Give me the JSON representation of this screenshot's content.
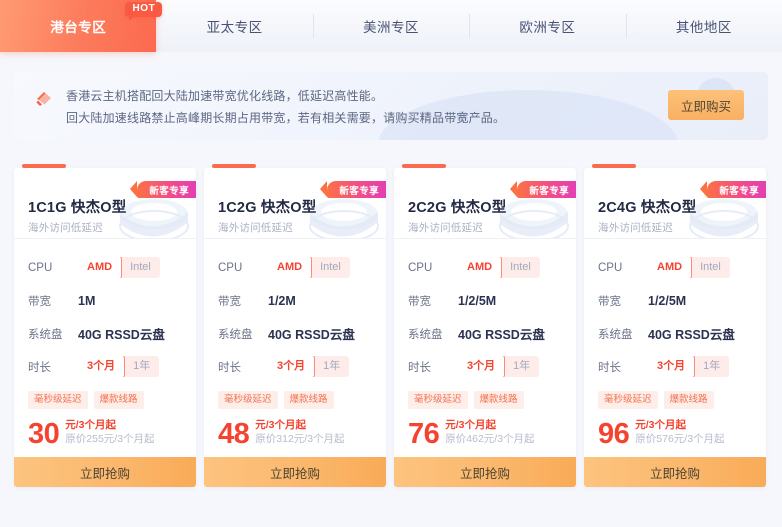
{
  "tabs": [
    {
      "label": "港台专区",
      "active": true,
      "badge": "HOT"
    },
    {
      "label": "亚太专区",
      "active": false,
      "badge": ""
    },
    {
      "label": "美洲专区",
      "active": false,
      "badge": ""
    },
    {
      "label": "欧洲专区",
      "active": false,
      "badge": ""
    },
    {
      "label": "其他地区",
      "active": false,
      "badge": ""
    }
  ],
  "notice": {
    "icon": "megaphone-icon",
    "line1": "香港云主机搭配回大陆加速带宽优化线路，低延迟高性能。",
    "line2": "回大陆加速线路禁止高峰期长期占用带宽，若有相关需要，请购买精品带宽产品。",
    "buy_label": "立即购买"
  },
  "labels": {
    "cpu": "CPU",
    "bandwidth": "带宽",
    "disk": "系统盘",
    "duration": "时长",
    "badge": "新客专享",
    "subtitle": "海外访问低延迟",
    "buy_now": "立即抢购",
    "cpu_amd": "AMD",
    "cpu_intel": "Intel",
    "dur_3m": "3个月",
    "dur_1y": "1年"
  },
  "colors": {
    "accent": "#fb6a4f",
    "price": "#f5432f",
    "button": "#fbb96f",
    "badge_start": "#fc7144",
    "badge_end": "#e23fb4"
  },
  "cards": [
    {
      "title": "1C1G 快杰O型",
      "subtitle": "海外访问低延迟",
      "badge": "新客专享",
      "cpu_selected": "AMD",
      "bandwidth": "1M",
      "disk": "40G RSSD云盘",
      "duration_selected": "3个月",
      "tags": [
        "毫秒级延迟",
        "爆款线路"
      ],
      "price": "30",
      "price_unit": "元/3个月起",
      "price_original": "原价255元/3个月起",
      "button": "立即抢购"
    },
    {
      "title": "1C2G 快杰O型",
      "subtitle": "海外访问低延迟",
      "badge": "新客专享",
      "cpu_selected": "AMD",
      "bandwidth": "1/2M",
      "disk": "40G RSSD云盘",
      "duration_selected": "3个月",
      "tags": [
        "毫秒级延迟",
        "爆款线路"
      ],
      "price": "48",
      "price_unit": "元/3个月起",
      "price_original": "原价312元/3个月起",
      "button": "立即抢购"
    },
    {
      "title": "2C2G 快杰O型",
      "subtitle": "海外访问低延迟",
      "badge": "新客专享",
      "cpu_selected": "AMD",
      "bandwidth": "1/2/5M",
      "disk": "40G RSSD云盘",
      "duration_selected": "3个月",
      "tags": [
        "毫秒级延迟",
        "爆款线路"
      ],
      "price": "76",
      "price_unit": "元/3个月起",
      "price_original": "原价462元/3个月起",
      "button": "立即抢购"
    },
    {
      "title": "2C4G 快杰O型",
      "subtitle": "海外访问低延迟",
      "badge": "新客专享",
      "cpu_selected": "AMD",
      "bandwidth": "1/2/5M",
      "disk": "40G RSSD云盘",
      "duration_selected": "3个月",
      "tags": [
        "毫秒级延迟",
        "爆款线路"
      ],
      "price": "96",
      "price_unit": "元/3个月起",
      "price_original": "原价576元/3个月起",
      "button": "立即抢购"
    }
  ]
}
